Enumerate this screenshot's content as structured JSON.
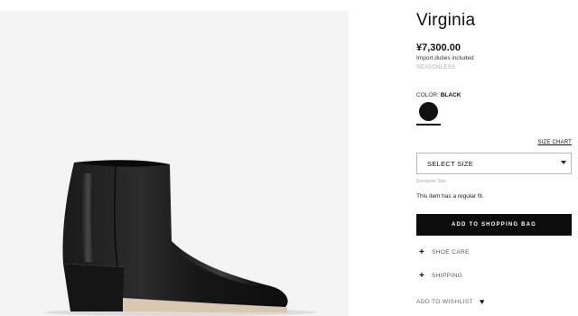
{
  "product": {
    "title": "Virginia",
    "price": "¥7,300.00",
    "duties_note": "Import duties included",
    "season": "SEASONLESS",
    "color_label": "COLOR:",
    "color_value": "BLACK",
    "swatch_color": "#111111",
    "image_icon": "black-ankle-boot-image"
  },
  "size": {
    "chart_link": "SIZE CHART",
    "select_placeholder": "SELECT SIZE",
    "system_note": "European Size",
    "fit_note": "This item has a regular fit."
  },
  "actions": {
    "add_to_bag": "ADD TO SHOPPING BAG",
    "wishlist": "ADD TO WISHLIST"
  },
  "accordion": [
    {
      "icon": "plus-icon",
      "label": "SHOE CARE"
    },
    {
      "icon": "plus-icon",
      "label": "SHIPPING"
    }
  ],
  "colors": {
    "button_bg": "#0c0c0c",
    "image_bg": "#f3f3f3"
  }
}
